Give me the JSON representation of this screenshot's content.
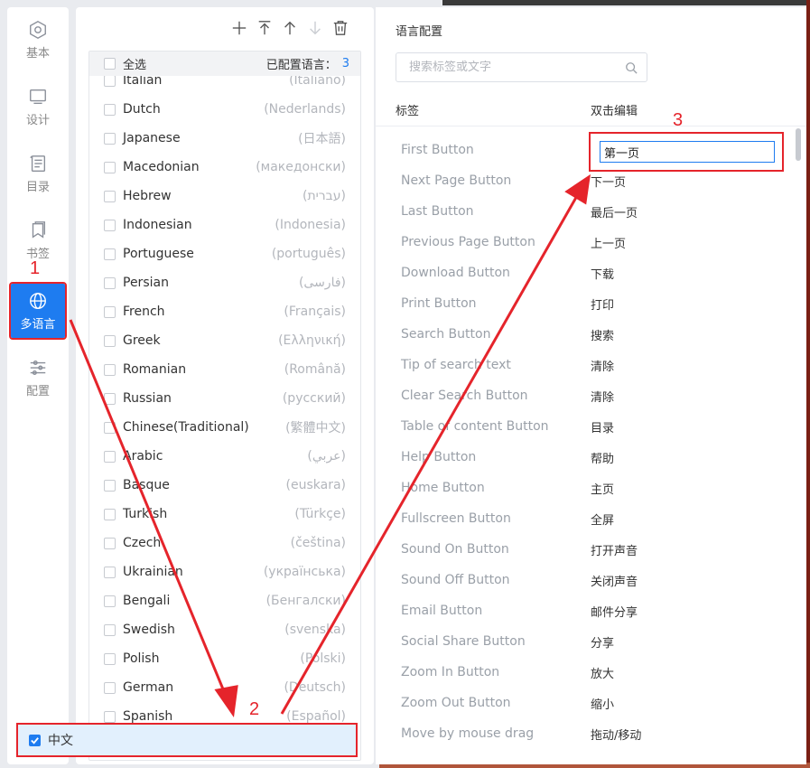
{
  "nav": {
    "items": [
      {
        "label": "基本",
        "icon": "hexagon-gear-icon"
      },
      {
        "label": "设计",
        "icon": "monitor-icon"
      },
      {
        "label": "目录",
        "icon": "catalog-icon"
      },
      {
        "label": "书签",
        "icon": "bookmark-icon"
      },
      {
        "label": "多语言",
        "icon": "globe-icon",
        "active": true
      },
      {
        "label": "配置",
        "icon": "sliders-icon"
      }
    ]
  },
  "toolbar": {
    "icons": [
      "plus-icon",
      "move-top-icon",
      "move-up-icon",
      "move-down-icon",
      "trash-icon"
    ]
  },
  "language_list": {
    "select_all": "全选",
    "configured_label": "已配置语言：",
    "configured_count": "3",
    "rows": [
      {
        "name": "Italian",
        "native": "(Italiano)"
      },
      {
        "name": "Dutch",
        "native": "(Nederlands)"
      },
      {
        "name": "Japanese",
        "native": "(日本語)"
      },
      {
        "name": "Macedonian",
        "native": "(македонски)"
      },
      {
        "name": "Hebrew",
        "native": "(עברית)"
      },
      {
        "name": "Indonesian",
        "native": "(Indonesia)"
      },
      {
        "name": "Portuguese",
        "native": "(português)"
      },
      {
        "name": "Persian",
        "native": "(فارسی)"
      },
      {
        "name": "French",
        "native": "(Français)"
      },
      {
        "name": "Greek",
        "native": "(Ελληνική)"
      },
      {
        "name": "Romanian",
        "native": "(Română)"
      },
      {
        "name": "Russian",
        "native": "(русский)"
      },
      {
        "name": "Chinese(Traditional)",
        "native": "(繁體中文)"
      },
      {
        "name": "Arabic",
        "native": "(عربي)"
      },
      {
        "name": "Basque",
        "native": "(euskara)"
      },
      {
        "name": "Turkish",
        "native": "(Türkçe)"
      },
      {
        "name": "Czech",
        "native": "(čeština)"
      },
      {
        "name": "Ukrainian",
        "native": "(українська)"
      },
      {
        "name": "Bengali",
        "native": "(Бенгалски)"
      },
      {
        "name": "Swedish",
        "native": "(svenska)"
      },
      {
        "name": "Polish",
        "native": "(Polski)"
      },
      {
        "name": "German",
        "native": "(Deutsch)"
      },
      {
        "name": "Spanish",
        "native": "(Español)"
      }
    ],
    "selected": {
      "name": "中文"
    }
  },
  "config": {
    "title": "语言配置",
    "search_placeholder": "搜索标签或文字",
    "col_tag": "标签",
    "col_edit": "双击编辑",
    "editing_value": "第一页",
    "rows": [
      {
        "tag": "First Button",
        "value": ""
      },
      {
        "tag": "Next Page Button",
        "value": "下一页"
      },
      {
        "tag": "Last Button",
        "value": "最后一页"
      },
      {
        "tag": "Previous Page Button",
        "value": "上一页"
      },
      {
        "tag": "Download Button",
        "value": "下载"
      },
      {
        "tag": "Print Button",
        "value": "打印"
      },
      {
        "tag": "Search Button",
        "value": "搜索"
      },
      {
        "tag": "Tip of search text",
        "value": "清除"
      },
      {
        "tag": "Clear Search Button",
        "value": "清除"
      },
      {
        "tag": "Table of content Button",
        "value": "目录"
      },
      {
        "tag": "Help Button",
        "value": "帮助"
      },
      {
        "tag": "Home Button",
        "value": "主页"
      },
      {
        "tag": "Fullscreen Button",
        "value": "全屏"
      },
      {
        "tag": "Sound On Button",
        "value": "打开声音"
      },
      {
        "tag": "Sound Off Button",
        "value": "关闭声音"
      },
      {
        "tag": "Email Button",
        "value": "邮件分享"
      },
      {
        "tag": "Social Share Button",
        "value": "分享"
      },
      {
        "tag": "Zoom In Button",
        "value": "放大"
      },
      {
        "tag": "Zoom Out Button",
        "value": "缩小"
      },
      {
        "tag": "Move by mouse drag",
        "value": "拖动/移动"
      }
    ]
  },
  "annotations": {
    "step1": "1",
    "step2": "2",
    "step3": "3",
    "color": "#e5242b"
  },
  "colors": {
    "accent": "#1e7cf0",
    "highlight": "#e5242b"
  }
}
